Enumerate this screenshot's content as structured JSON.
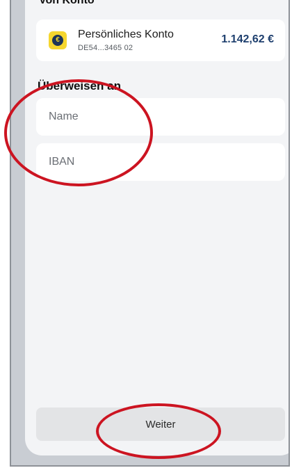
{
  "from_account": {
    "section_label": "Von Konto",
    "account_name": "Persönliches Konto",
    "account_iban": "DE54...3465 02",
    "balance": "1.142,62 €",
    "icon": "euro-icon"
  },
  "transfer_to": {
    "section_title": "Überweisen an",
    "name_placeholder": "Name",
    "iban_placeholder": "IBAN"
  },
  "actions": {
    "next_label": "Weiter"
  },
  "colors": {
    "annotation": "#cc1421",
    "icon_background": "#f5d62f",
    "balance_text": "#1e3f6e",
    "screen_background": "#f3f4f6"
  }
}
